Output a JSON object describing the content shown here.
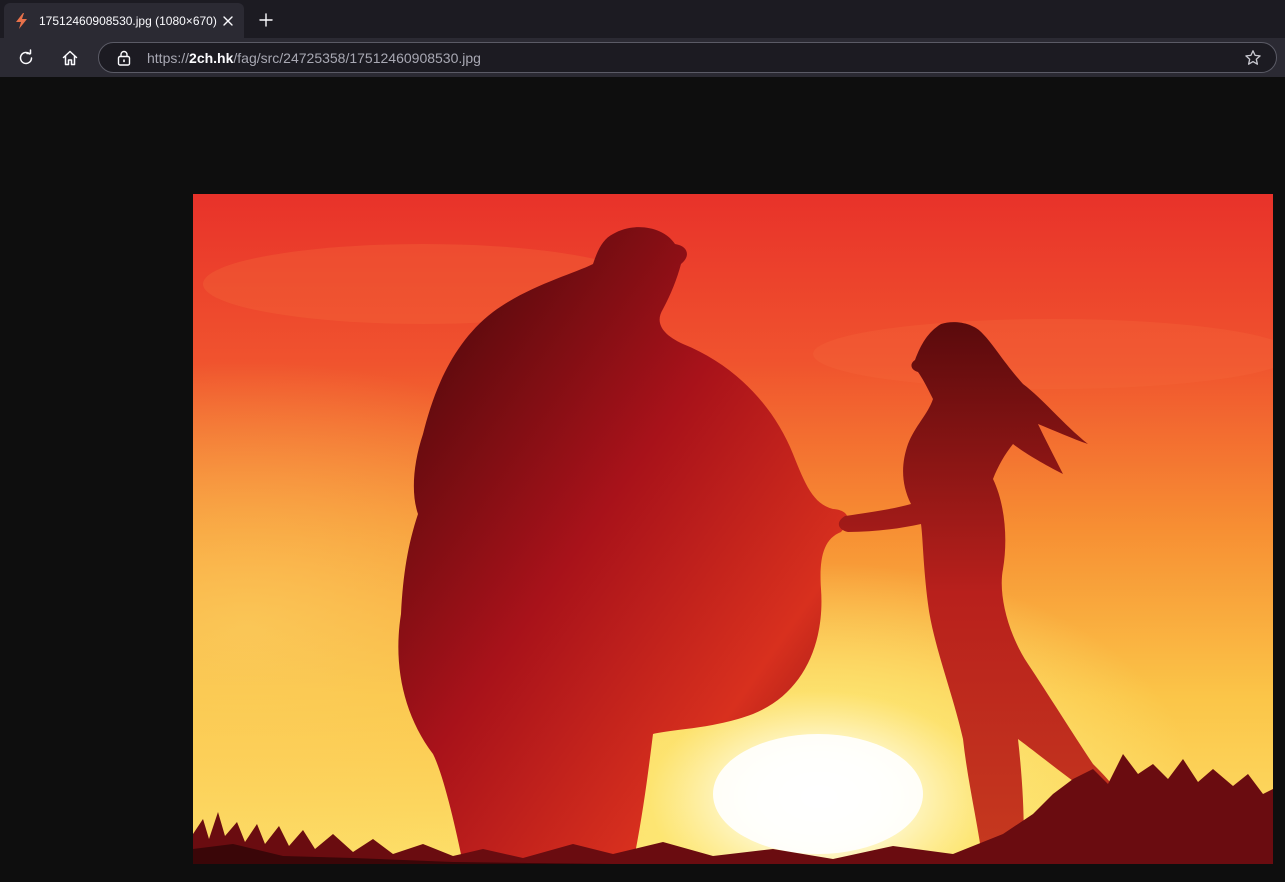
{
  "tab": {
    "title": "17512460908530.jpg (1080×670)",
    "favicon": "bolt-icon"
  },
  "navbar": {
    "url_prefix": "https://",
    "url_host": "2ch.hk",
    "url_path": "/fag/src/24725358/17512460908530.jpg"
  },
  "colors": {
    "tabstrip_bg": "#1c1b22",
    "toolbar_bg": "#2b2a33",
    "page_bg": "#0e0e0e",
    "favicon": "#e8714a"
  },
  "image": {
    "subject": "silhouette of a heavy man and a slim woman holding hands at sunset"
  }
}
